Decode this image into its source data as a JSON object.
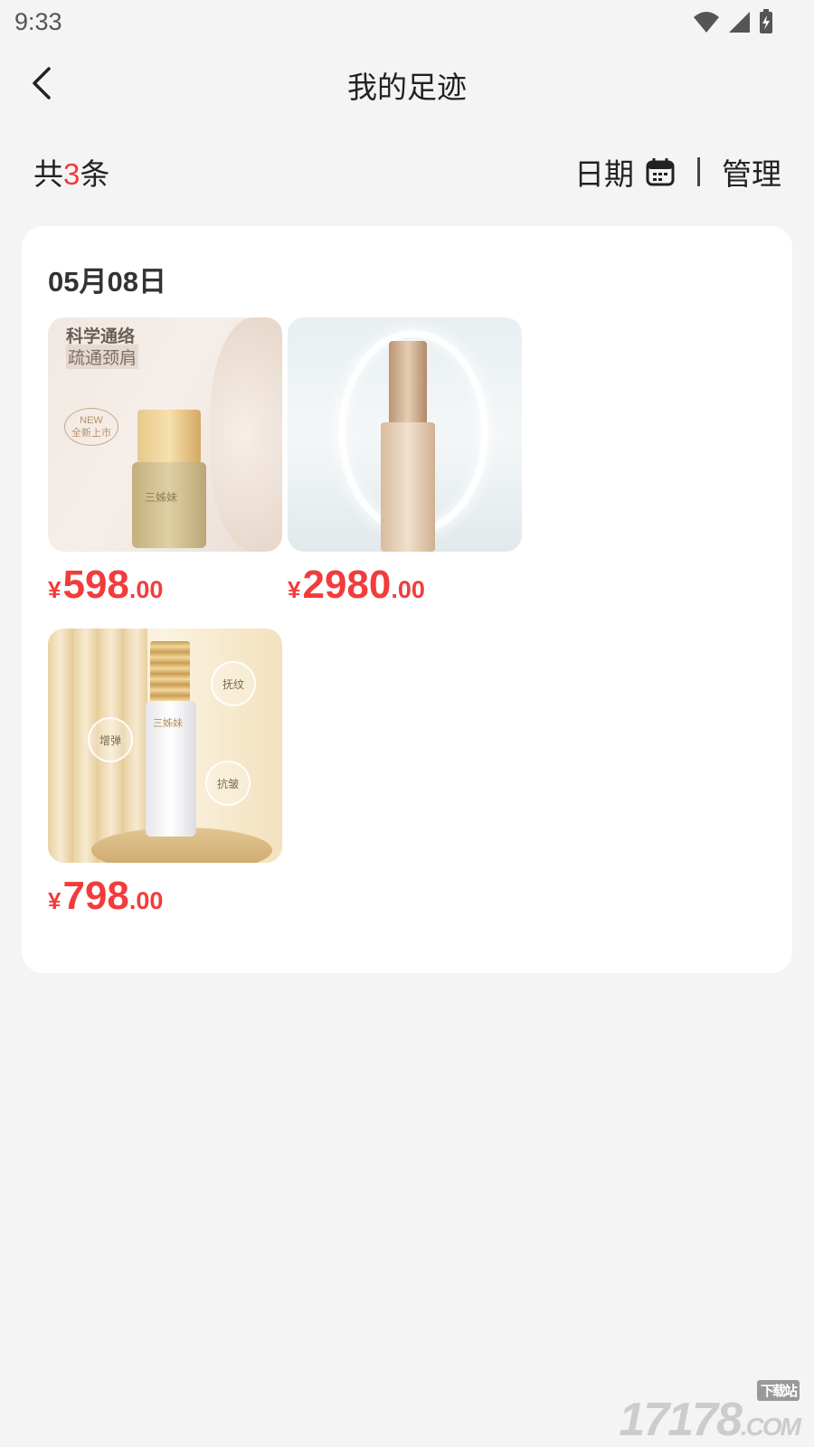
{
  "status_bar": {
    "time": "9:33"
  },
  "header": {
    "title": "我的足迹"
  },
  "summary": {
    "prefix": "共",
    "count": "3",
    "suffix": "条"
  },
  "toolbar": {
    "date_label": "日期",
    "manage_label": "管理"
  },
  "group": {
    "date": "05月08日",
    "products": [
      {
        "currency": "¥",
        "price_int": "598",
        "price_dec": ".00",
        "image_text_1": "科学通络",
        "image_text_2": "疏通颈肩",
        "badge_1": "NEW",
        "badge_2": "全新上市",
        "brand": "三姊妹"
      },
      {
        "currency": "¥",
        "price_int": "2980",
        "price_dec": ".00"
      },
      {
        "currency": "¥",
        "price_int": "798",
        "price_dec": ".00",
        "bubble_1": "抚纹",
        "bubble_2": "增弹",
        "bubble_3": "抗皱",
        "brand": "三姊妹"
      }
    ]
  },
  "watermark": {
    "main": "17178",
    "sub": "下载站",
    "tld": ".COM"
  }
}
